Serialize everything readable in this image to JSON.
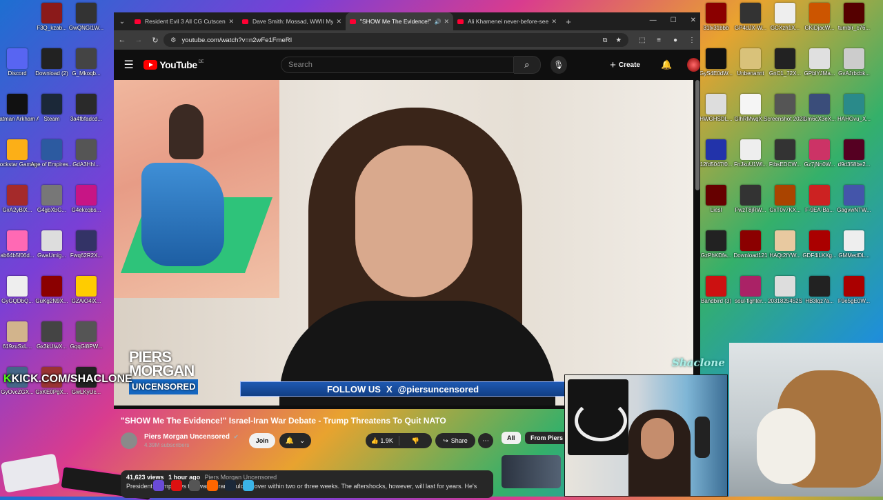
{
  "desktop": {
    "left_icons": [
      {
        "label": "F3Q_kzab...",
        "color": "#8b1a1a"
      },
      {
        "label": "GwQNGl1W...",
        "color": "#333333"
      },
      {
        "label": "Discord",
        "color": "#5865f2"
      },
      {
        "label": "Download (2)",
        "color": "#222222"
      },
      {
        "label": "G_Mkoqb...",
        "color": "#444444"
      },
      {
        "label": "Batman Arkham As...",
        "color": "#111111"
      },
      {
        "label": "Steam",
        "color": "#1b2838"
      },
      {
        "label": "3a4fbfadcd...",
        "color": "#2a2a2a"
      },
      {
        "label": "Rockstar Games ...",
        "color": "#fcaf17"
      },
      {
        "label": "Age of Empires...",
        "color": "#2c5aa0"
      },
      {
        "label": "GdA3HhI...",
        "color": "#555555"
      },
      {
        "label": "GxA2yBlX...",
        "color": "#a52a2a"
      },
      {
        "label": "G4gbXbG...",
        "color": "#777777"
      },
      {
        "label": "G4ekcqbs...",
        "color": "#c71585"
      },
      {
        "label": "ab64b5f06d...",
        "color": "#ff69b4"
      },
      {
        "label": "GwaUmig...",
        "color": "#dddddd"
      },
      {
        "label": "Fwq62R2X...",
        "color": "#333366"
      },
      {
        "label": "GyGQDbQ...",
        "color": "#eeeeee"
      },
      {
        "label": "GuKg2N9X...",
        "color": "#8b0000"
      },
      {
        "label": "GZAiO4iX...",
        "color": "#ffcc00"
      },
      {
        "label": "619zuSxL...",
        "color": "#d2b48c"
      },
      {
        "label": "Gx3kUlwX...",
        "color": "#444444"
      },
      {
        "label": "GqqGl8PW...",
        "color": "#555555"
      },
      {
        "label": "GyOvcZGX...",
        "color": "#446688"
      },
      {
        "label": "GxKE0PgX...",
        "color": "#993333"
      },
      {
        "label": "GwLKyUc...",
        "color": "#222222"
      }
    ],
    "right_icons": [
      {
        "label": "31lx31bbb",
        "color": "#8b0000"
      },
      {
        "label": "GP4dJX-W...",
        "color": "#333333"
      },
      {
        "label": "GCXzh1X...",
        "color": "#eeeeee"
      },
      {
        "label": "GKiDjacW...",
        "color": "#cc5500"
      },
      {
        "label": "tumblr_c76...",
        "color": "#550000"
      },
      {
        "label": "GyS4E0dW...",
        "color": "#111111"
      },
      {
        "label": "Unbenannt",
        "color": "#d9c27a"
      },
      {
        "label": "GnC1_72X...",
        "color": "#222222"
      },
      {
        "label": "GPblYJMa...",
        "color": "#e0e0e0"
      },
      {
        "label": "GvAJrbcbk...",
        "color": "#cccccc"
      },
      {
        "label": "HWGHSDL...",
        "color": "#dddddd"
      },
      {
        "label": "GlhRMwqX...",
        "color": "#f5f5f5"
      },
      {
        "label": "Screenshot 2023-06-...",
        "color": "#555555"
      },
      {
        "label": "Gm6cX3eX...",
        "color": "#3a4d7a"
      },
      {
        "label": "HAHGvu_X...",
        "color": "#2a8a8a"
      },
      {
        "label": "12fd5047f0...",
        "color": "#2233aa"
      },
      {
        "label": "FnJkuU1Wl...",
        "color": "#eeeeee"
      },
      {
        "label": "FtbsEDCW...",
        "color": "#333333"
      },
      {
        "label": "Gz7jNn0W...",
        "color": "#cc3366"
      },
      {
        "label": "d9d358be2...",
        "color": "#550022"
      },
      {
        "label": "Liesl",
        "color": "#660000"
      },
      {
        "label": "FwzT8jRW...",
        "color": "#333333"
      },
      {
        "label": "GxT0v7KX...",
        "color": "#aa4400"
      },
      {
        "label": "F-9EA-Ba...",
        "color": "#cc2222"
      },
      {
        "label": "GagvwNTW...",
        "color": "#4455aa"
      },
      {
        "label": "GzPhKDfa...",
        "color": "#222222"
      },
      {
        "label": "Download121",
        "color": "#8b0000"
      },
      {
        "label": "HAQt2fYW...",
        "color": "#e8c9a0"
      },
      {
        "label": "GDF4iLKXg...",
        "color": "#aa0000"
      },
      {
        "label": "GMMedDL...",
        "color": "#eeeeee"
      },
      {
        "label": "Bandbird (3)",
        "color": "#cc1111"
      },
      {
        "label": "soul-fighter...",
        "color": "#aa2266"
      },
      {
        "label": "2031825452S",
        "color": "#dddddd"
      },
      {
        "label": "HB3lqz7a...",
        "color": "#222222"
      },
      {
        "label": "F9e5gE0W...",
        "color": "#aa0000"
      }
    ],
    "kick_text": "KICK.COM/SHACLONE",
    "overlay_name": "Shaclone"
  },
  "browser": {
    "tabs": [
      {
        "title": "Resident Evil 3 All CG Cutscenes",
        "active": false
      },
      {
        "title": "Dave Smith: Mossad, WWII Myth",
        "active": false
      },
      {
        "title": "\"SHOW Me The Evidence!\"",
        "active": true
      },
      {
        "title": "Ali Khamenei never-before-seen",
        "active": false
      }
    ],
    "url": "youtube.com/watch?v=n2wFe1FmeRI"
  },
  "youtube": {
    "logo_text": "YouTube",
    "country_code": "DE",
    "search_placeholder": "Search",
    "create_label": "Create",
    "video": {
      "brand_line1": "PIERS",
      "brand_line2": "MORGAN",
      "brand_line3": "UNCENSORED",
      "follow_text": "FOLLOW US",
      "follow_x": "X",
      "follow_handle": "@piersuncensored"
    },
    "title": "\"SHOW Me The Evidence!\" Israel-Iran War Debate - Trump Threatens To Quit NATO",
    "channel": {
      "name": "Piers Morgan Uncensored",
      "verified": "✔",
      "subscribers": "4.39M subscribers"
    },
    "join_label": "Join",
    "likes": "1.9K",
    "share_label": "Share",
    "chips": [
      "All",
      "From Piers"
    ],
    "description": {
      "views": "41,623 views",
      "time": "1 hour ago",
      "channel_tag": "Piers Morgan Uncensored",
      "text": "President Trump says the war in Iran could be over within two or three weeks. The aftershocks, however, will last for years. He's"
    }
  }
}
